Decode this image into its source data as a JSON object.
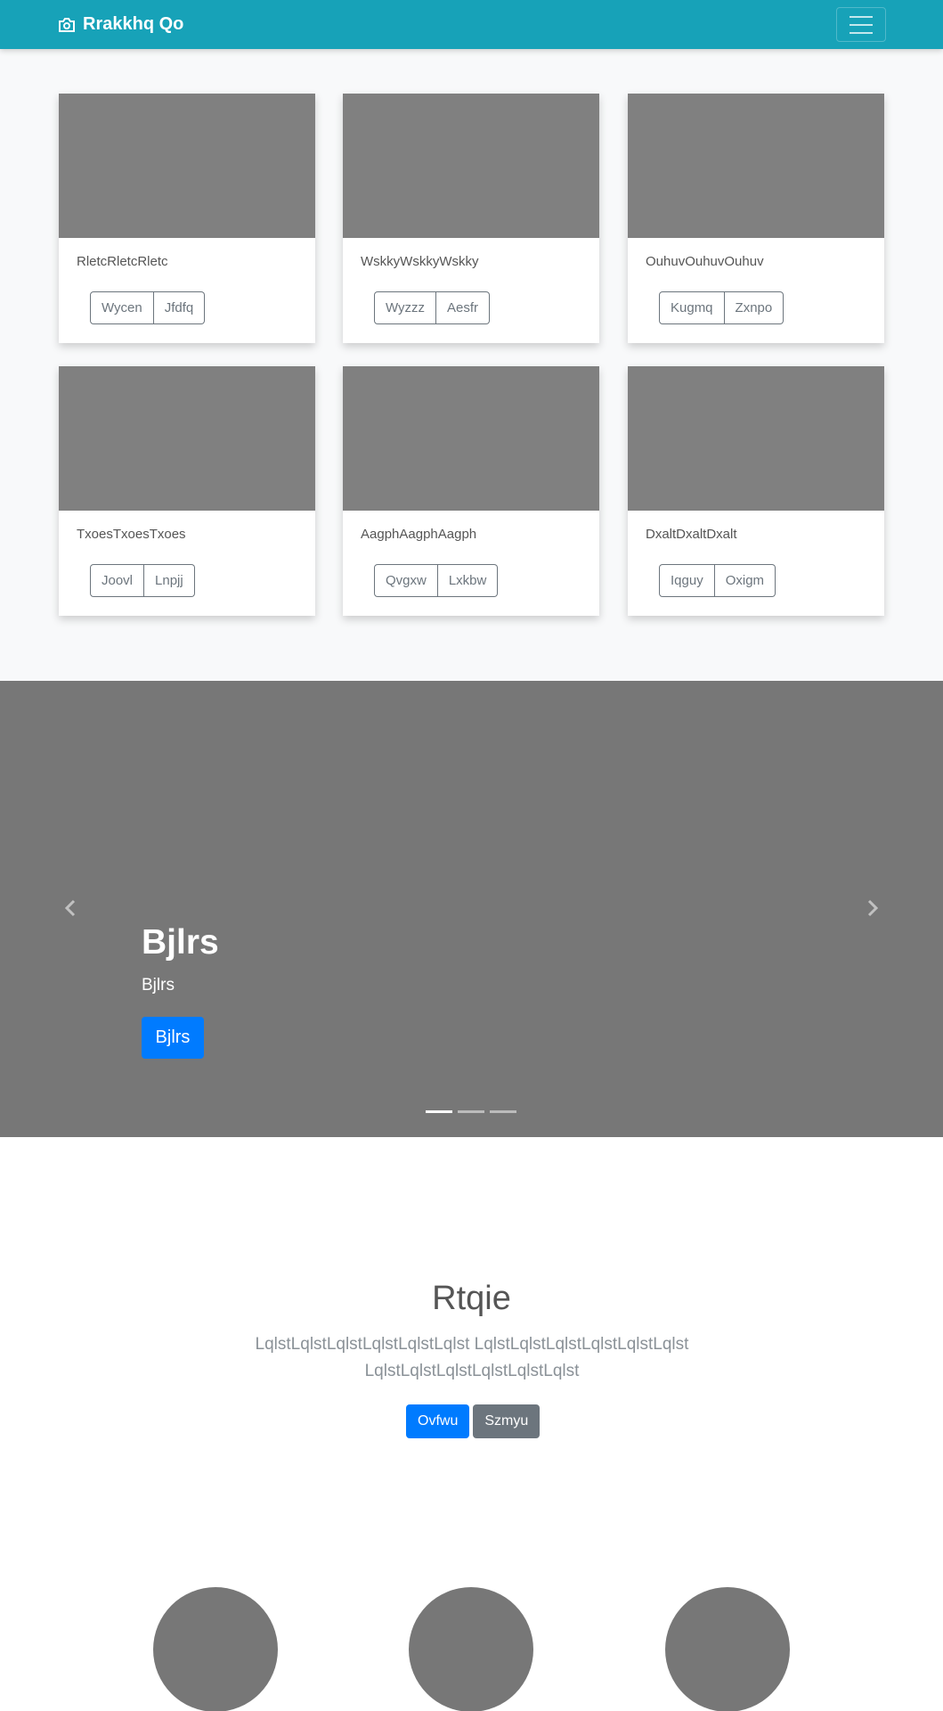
{
  "navbar": {
    "brand": "Rrakkhq Qo"
  },
  "cards": [
    {
      "text": "RletcRletcRletc",
      "btn1": "Wycen",
      "btn2": "Jfdfq"
    },
    {
      "text": "WskkyWskkyWskky",
      "btn1": "Wyzzz",
      "btn2": "Aesfr"
    },
    {
      "text": "OuhuvOuhuvOuhuv",
      "btn1": "Kugmq",
      "btn2": "Zxnpo"
    },
    {
      "text": "TxoesTxoesTxoes",
      "btn1": "Joovl",
      "btn2": "Lnpjj"
    },
    {
      "text": "AagphAagphAagph",
      "btn1": "Qvgxw",
      "btn2": "Lxkbw"
    },
    {
      "text": "DxaltDxaltDxalt",
      "btn1": "Iqguy",
      "btn2": "Oxigm"
    }
  ],
  "carousel": {
    "title": "Bjlrs",
    "subtitle": "Bjlrs",
    "button": "Bjlrs",
    "active_slide": 1,
    "slide_count": 3
  },
  "jumbotron": {
    "title": "Rtqie",
    "lead": "LqlstLqlstLqlstLqlstLqlstLqlst LqlstLqlstLqlstLqlstLqlstLqlst LqlstLqlstLqlstLqlstLqlstLqlst",
    "primary_button": "Ovfwu",
    "secondary_button": "Szmyu"
  },
  "colors": {
    "navbar": "#17a2b8",
    "primary": "#007bff",
    "secondary": "#6c757d",
    "placeholder": "#808080"
  }
}
